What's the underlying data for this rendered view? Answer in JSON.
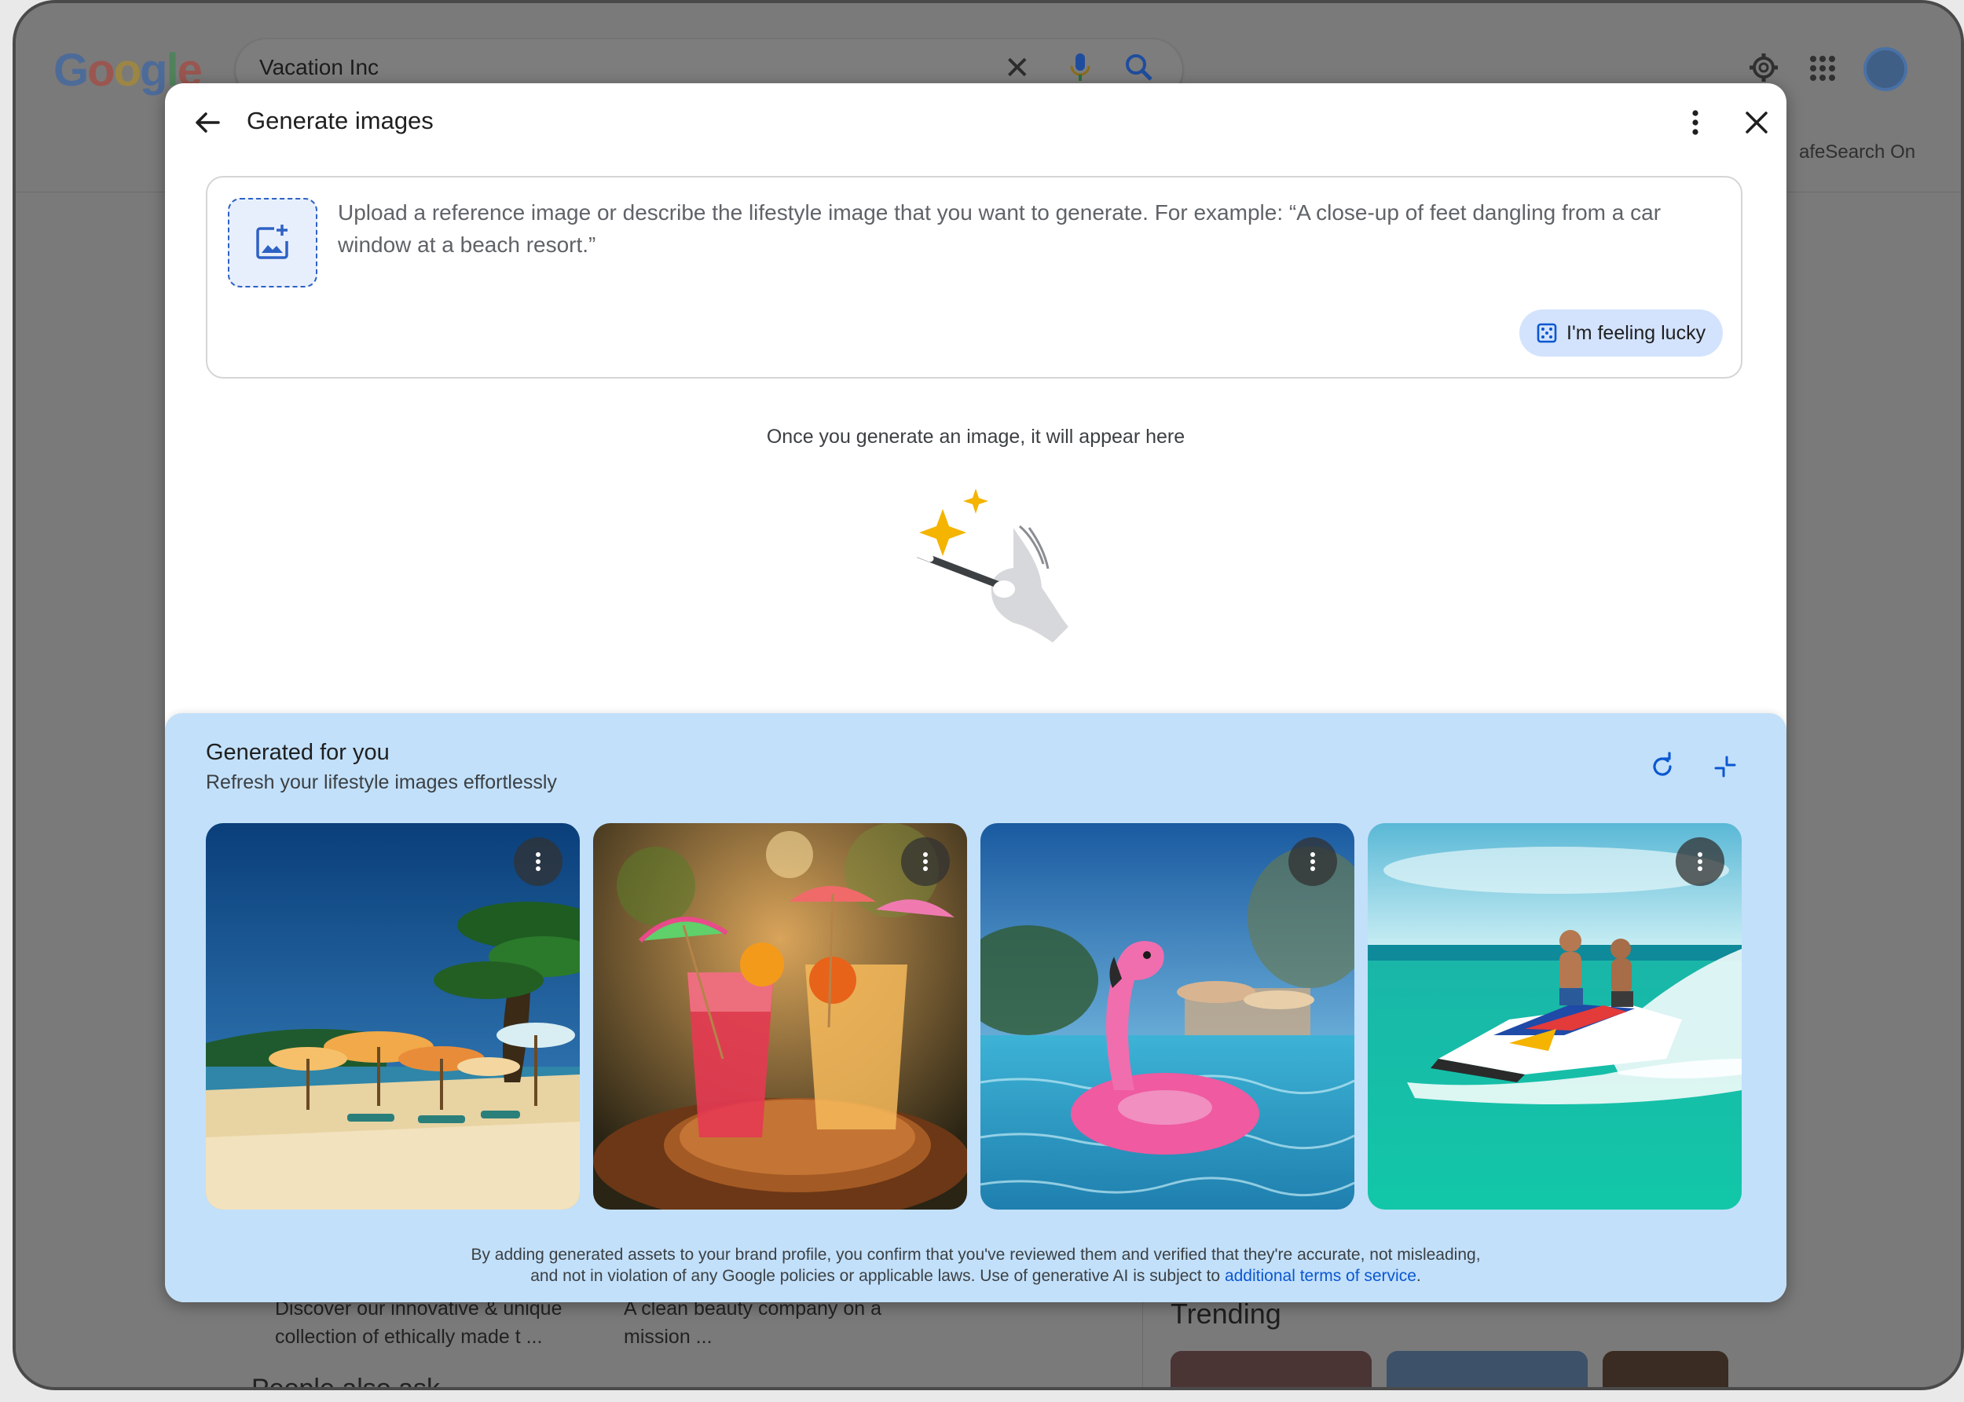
{
  "background_page": {
    "logo": "Google",
    "search_value": "Vacation Inc",
    "safesearch": "afeSearch On",
    "snippets": [
      {
        "line1": "Discover our innovative & unique",
        "line2": "collection of ethically made t ..."
      },
      {
        "line1": "A clean beauty company on a",
        "line2": "mission ..."
      }
    ],
    "people_also_ask": "People also ask",
    "trending": "Trending"
  },
  "modal": {
    "title": "Generate images",
    "prompt_placeholder": "Upload a reference image or describe the lifestyle image that you want to generate. For example: “A close-up of feet dangling from a car window at a beach resort.”",
    "lucky_label": "I'm feeling lucky",
    "empty_caption": "Once you generate an image, it will appear here"
  },
  "generated": {
    "title": "Generated for you",
    "subtitle": "Refresh your lifestyle images effortlessly",
    "images": [
      {
        "name": "beach-umbrellas"
      },
      {
        "name": "cocktails"
      },
      {
        "name": "flamingo-float"
      },
      {
        "name": "jet-ski"
      }
    ],
    "disclaimer_line1": "By adding generated assets to your brand profile, you confirm that you've reviewed them and verified that they're accurate, not misleading,",
    "disclaimer_line2": "and not in violation of any Google policies or applicable laws. Use of generative AI is subject to",
    "terms_link": "additional terms of service",
    "period": "."
  },
  "colors": {
    "accent": "#0b57d0",
    "panel_bg": "#c2e0fa",
    "chip_bg": "#d3e3fd"
  }
}
